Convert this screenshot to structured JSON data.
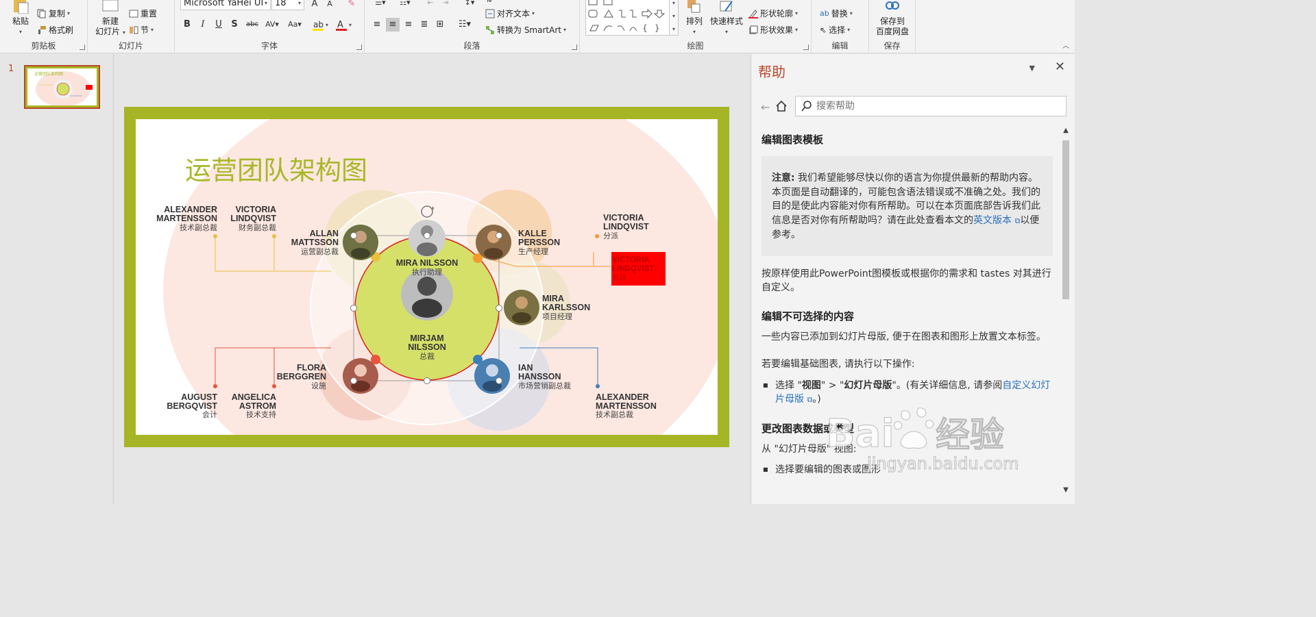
{
  "ribbon": {
    "clipboard": {
      "paste": "粘贴",
      "copy": "复制",
      "format_painter": "格式刷",
      "label": "剪贴板"
    },
    "slides": {
      "new_slide_line1": "新建",
      "new_slide_line2": "幻灯片",
      "reset": "重置",
      "section": "节",
      "label": "幻灯片"
    },
    "font": {
      "name": "Microsoft YaHei UI",
      "size": "18",
      "label": "字体"
    },
    "paragraph": {
      "align_text": "对齐文本",
      "convert_smartart": "转换为 SmartArt",
      "label": "段落"
    },
    "drawing": {
      "arrange": "排列",
      "quick_styles": "快速样式",
      "shape_outline": "形状轮廓",
      "shape_effects": "形状效果",
      "label": "绘图"
    },
    "editing": {
      "replace": "替换",
      "select": "选择",
      "label": "编辑"
    },
    "save": {
      "save_baidu_line1": "保存到",
      "save_baidu_line2": "百度网盘",
      "label": "保存"
    }
  },
  "thumbnails": {
    "slide_number": "1"
  },
  "slide": {
    "title": "运营团队架构图",
    "people": [
      {
        "name1": "MIRA NILSSON",
        "name2": "",
        "role": "执行助理"
      },
      {
        "name1": "MIRJAM",
        "name2": "NILSSON",
        "role": "总裁"
      },
      {
        "name1": "ALLAN",
        "name2": "MATTSSON",
        "role": "运营副总裁"
      },
      {
        "name1": "KALLE",
        "name2": "PERSSON",
        "role": "生产经理"
      },
      {
        "name1": "MIRA",
        "name2": "KARLSSON",
        "role": "项目经理"
      },
      {
        "name1": "FLORA",
        "name2": "BERGGREN",
        "role": "设施"
      },
      {
        "name1": "IAN",
        "name2": "HANSSON",
        "role": "市场营销副总裁"
      },
      {
        "name1": "ALEXANDER",
        "name2": "MARTENSSON",
        "role": "技术副总裁"
      },
      {
        "name1": "VICTORIA",
        "name2": "LINDQVIST",
        "role": "财务副总裁"
      },
      {
        "name1": "VICTORIA",
        "name2": "LINDQVIST",
        "role": "分派"
      },
      {
        "name1": "VICTORIA",
        "name2": "LINDQVIST",
        "role": "分派"
      },
      {
        "name1": "AUGUST",
        "name2": "BERGQVIST",
        "role": "会计"
      },
      {
        "name1": "ANGELICA",
        "name2": "ASTROM",
        "role": "技术支持"
      },
      {
        "name1": "ALEXANDER",
        "name2": "MARTENSSON",
        "role": "技术副总裁"
      }
    ]
  },
  "help": {
    "title": "帮助",
    "search_placeholder": "搜索帮助",
    "heading": "编辑图表模板",
    "note_label": "注意:",
    "note_text": " 我们希望能够尽快以你的语言为你提供最新的帮助内容。本页面是自动翻译的，可能包含语法错误或不准确之处。我们的目的是使此内容能对你有所帮助。可以在本页面底部告诉我们此信息是否对你有所帮助吗？请在此处查看本文的",
    "note_link": "英文版本",
    "note_tail": "以便参考。",
    "intro": "按原样使用此PowerPoint图模板或根据你的需求和 tastes 对其进行自定义。",
    "h2": "编辑不可选择的内容",
    "p2": "一些内容已添加到幻灯片母版, 便于在图表和图形上放置文本标签。",
    "p3": "若要编辑基础图表, 请执行以下操作:",
    "bullet_pre": "选择 \"",
    "bullet_view": "视图",
    "bullet_mid": "\" > \"",
    "bullet_master": "幻灯片母版",
    "bullet_after": "\"。(有关详细信息, 请参阅",
    "bullet_link": "自定义幻灯片母版",
    "bullet_end": "。)",
    "h3": "更改图表数据或类型",
    "p4": "从 \"幻灯片母版\" 视图:",
    "p5": "选择要编辑的图表或图形"
  },
  "colors": {
    "accent": "#b7472a",
    "slide_frame": "#a6b526",
    "title_green": "#a8b82a",
    "link": "#2a6fbd"
  }
}
